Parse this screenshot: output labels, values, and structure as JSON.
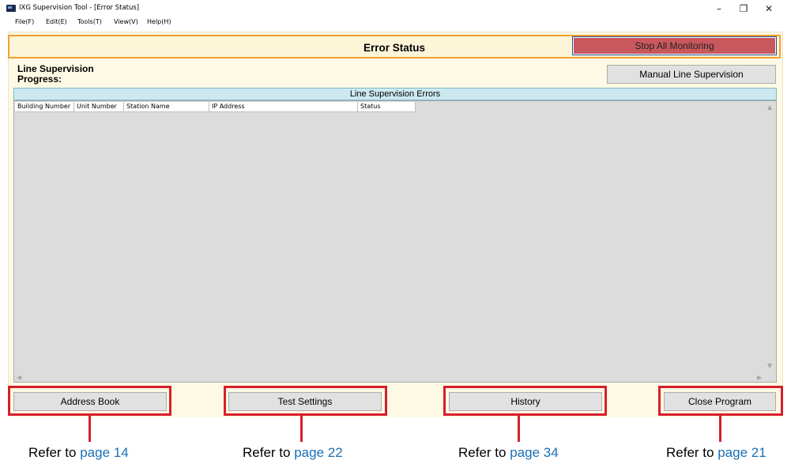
{
  "window": {
    "title": "IXG Supervision Tool - [Error Status]",
    "controls": {
      "minimize": "–",
      "restore": "❐",
      "close": "✕"
    }
  },
  "menu": [
    "File(F)",
    "Edit(E)",
    "Tools(T)",
    "View(V)",
    "Help(H)"
  ],
  "header": {
    "title": "Error Status",
    "stop_button": "Stop All Monitoring"
  },
  "line_supervision": {
    "label": "Line Supervision",
    "progress_label": "Progress:",
    "manual_button": "Manual Line Supervision"
  },
  "errors_table": {
    "caption": "Line Supervision Errors",
    "columns": [
      "Building Number",
      "Unit Number",
      "Station Name",
      "IP Address",
      "Status"
    ],
    "rows": []
  },
  "buttons": {
    "address_book": "Address Book",
    "test_settings": "Test Settings",
    "history": "History",
    "close_program": "Close Program"
  },
  "references": [
    {
      "text": "Refer to ",
      "page": "page 14"
    },
    {
      "text": "Refer to ",
      "page": "page 22"
    },
    {
      "text": "Refer to ",
      "page": "page 34"
    },
    {
      "text": "Refer to ",
      "page": "page 21"
    }
  ],
  "colors": {
    "accent_stop": "#c9585e",
    "header_border": "#f0a030",
    "highlight": "#d71f2b",
    "link": "#1b6fb5",
    "table_caption_bg": "#cde9f0"
  }
}
